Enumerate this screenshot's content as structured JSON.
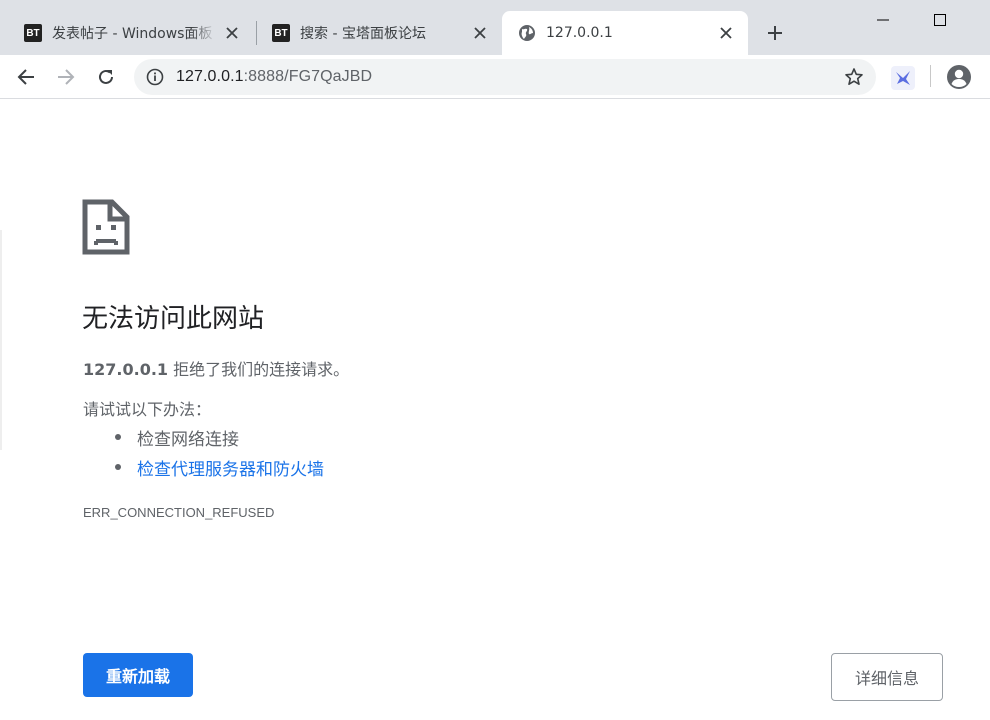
{
  "browser": {
    "tabs": [
      {
        "title": "发表帖子 - Windows面板",
        "icon": "bt-logo",
        "icon_text": "BT"
      },
      {
        "title": "搜索 - 宝塔面板论坛",
        "icon": "bt-logo",
        "icon_text": "BT"
      },
      {
        "title": "127.0.0.1",
        "icon": "globe-icon",
        "active": true
      }
    ],
    "address": {
      "host": "127.0.0.1",
      "rest": ":8888/FG7QaJBD"
    }
  },
  "error_page": {
    "title": "无法访问此网站",
    "summary_host": "127.0.0.1",
    "summary_text": " 拒绝了我们的连接请求。",
    "try_label": "请试试以下办法：",
    "suggestions": [
      "检查网络连接",
      "检查代理服务器和防火墙"
    ],
    "error_code": "ERR_CONNECTION_REFUSED",
    "reload_label": "重新加载",
    "details_label": "详细信息"
  },
  "colors": {
    "accent": "#1a73e8",
    "tabstrip": "#dee1e6",
    "text_secondary": "#5f6368"
  }
}
